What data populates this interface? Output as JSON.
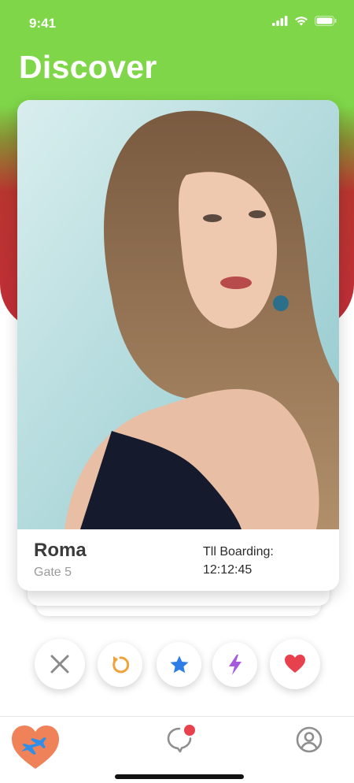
{
  "status_bar": {
    "time": "9:41"
  },
  "header": {
    "title": "Discover"
  },
  "card": {
    "name": "Roma",
    "gate": "Gate 5",
    "boarding_label": "Tll Boarding:",
    "boarding_time": "12:12:45"
  },
  "actions": [
    {
      "icon": "close-icon",
      "color": "#8a8a8a"
    },
    {
      "icon": "rewind-icon",
      "color": "#f1a23a"
    },
    {
      "icon": "star-icon",
      "color": "#2f7ee6"
    },
    {
      "icon": "bolt-icon",
      "color": "#a55be0"
    },
    {
      "icon": "heart-icon",
      "color": "#e8414e"
    }
  ],
  "tabs": [
    {
      "icon": "plane-heart-icon",
      "active": true,
      "color": "#f0825a"
    },
    {
      "icon": "chat-icon",
      "badge": true,
      "badge_color": "#e8414e"
    },
    {
      "icon": "profile-icon"
    }
  ],
  "colors": {
    "header_green": "#7ed648",
    "header_red": "#c12d38"
  }
}
